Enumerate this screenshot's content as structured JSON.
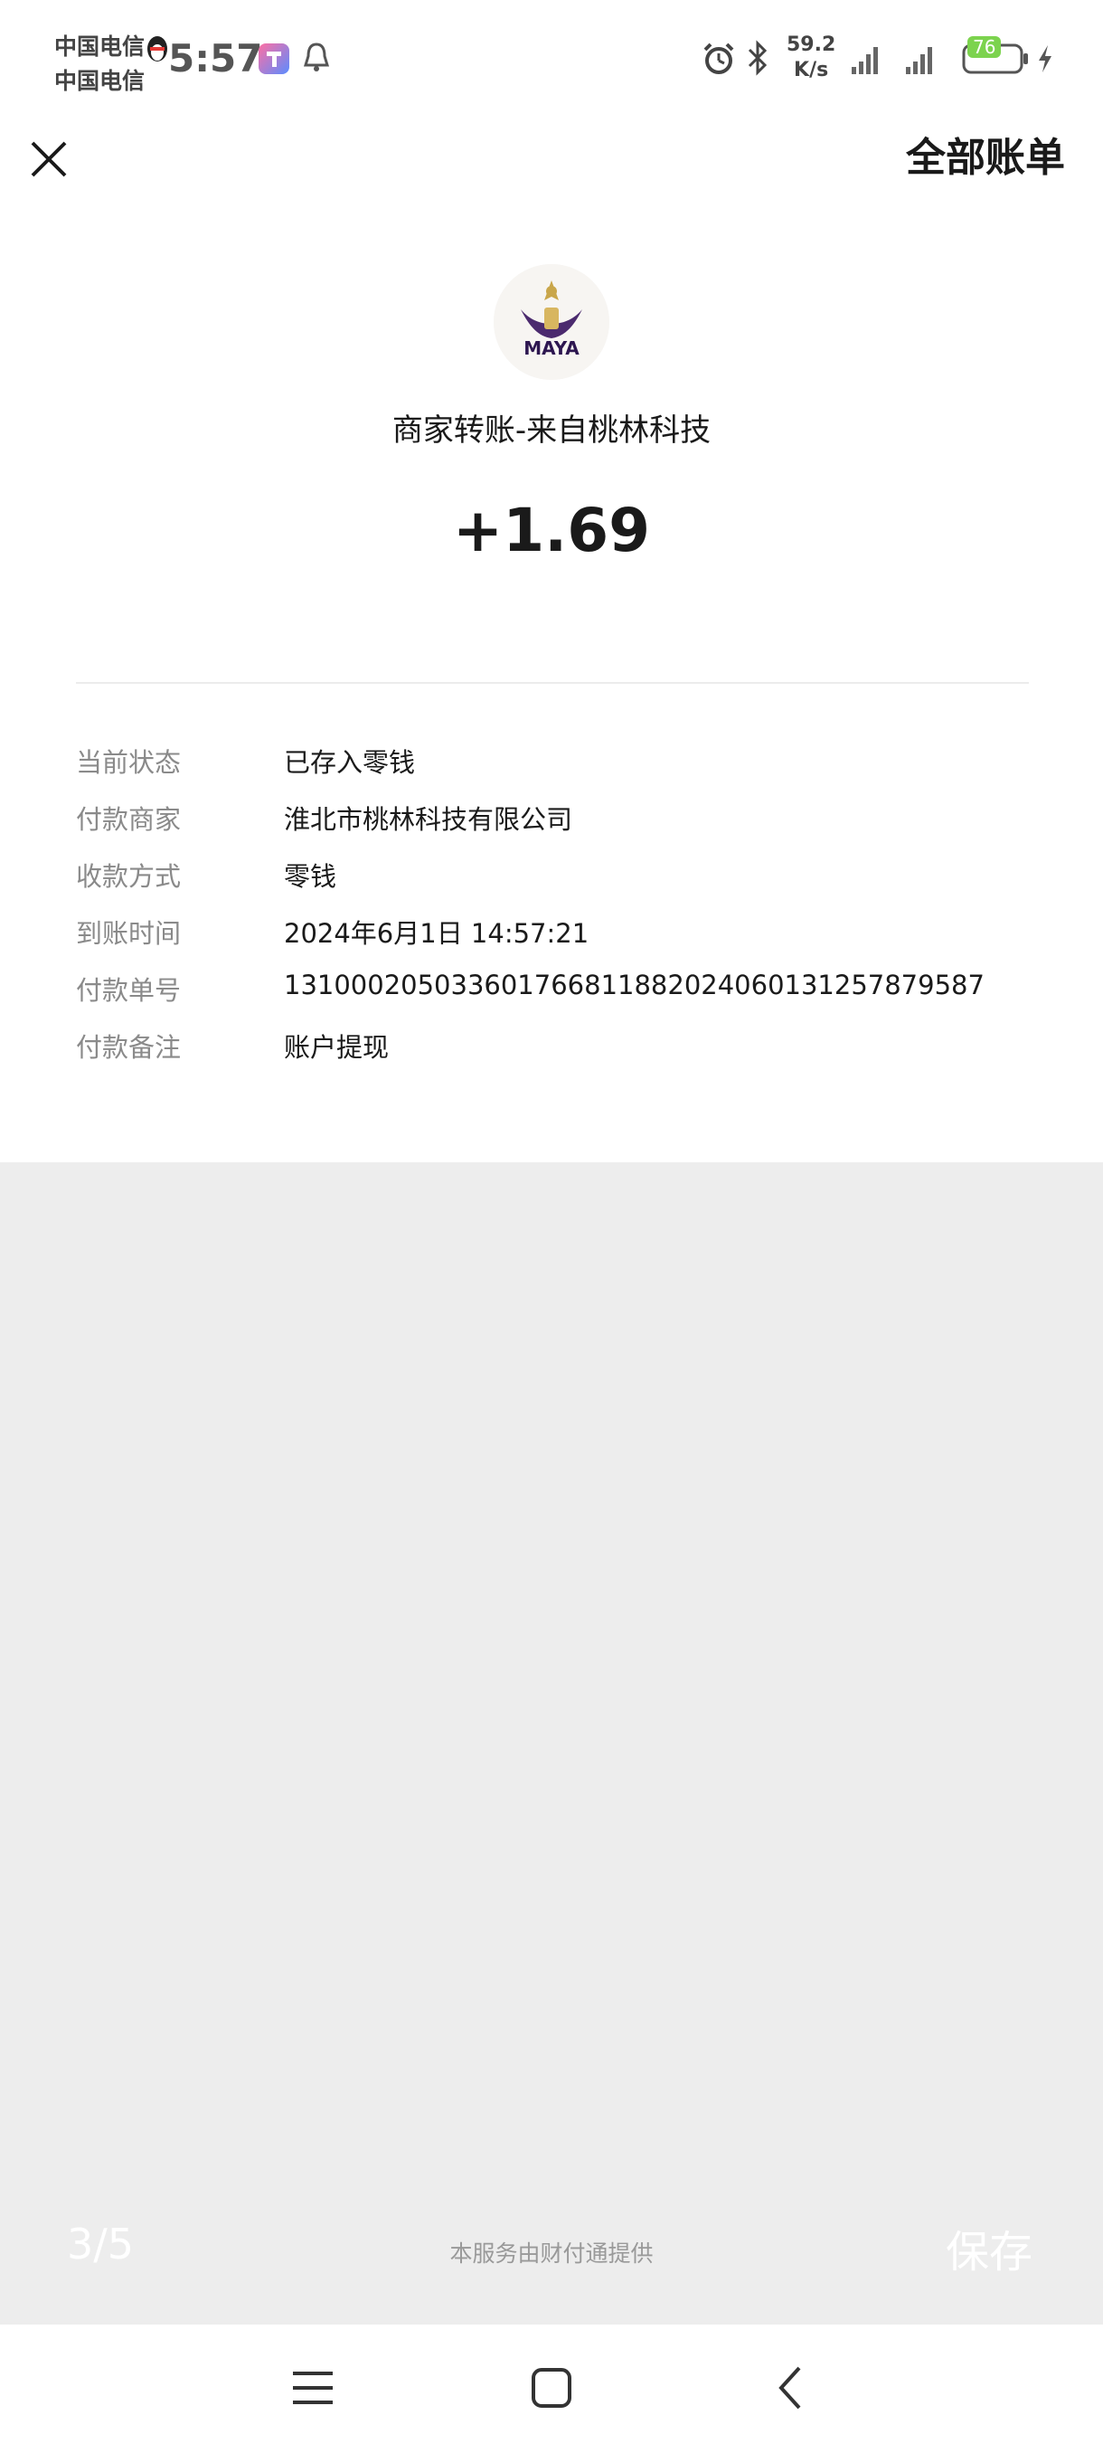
{
  "status_bar": {
    "carrier_1": "中国电信",
    "carrier_2": "中国电信",
    "time": "5:57",
    "net_speed_value": "59.2",
    "net_speed_unit": "K/s",
    "battery": "76",
    "icons": [
      "qq-penguin-icon",
      "app-icon",
      "notification-bell-icon",
      "alarm-icon",
      "bluetooth-icon",
      "signal-icon",
      "battery-icon",
      "charging-icon"
    ]
  },
  "header": {
    "close_icon": "close-icon",
    "all_bills_label": "全部账单"
  },
  "transaction": {
    "logo_text": "MAYA",
    "title": "商家转账-来自桃林科技",
    "amount": "+1.69"
  },
  "details": [
    {
      "label": "当前状态",
      "value": "已存入零钱"
    },
    {
      "label": "付款商家",
      "value": "淮北市桃林科技有限公司"
    },
    {
      "label": "收款方式",
      "value": "零钱"
    },
    {
      "label": "到账时间",
      "value": "2024年6月1日 14:57:21"
    },
    {
      "label": "付款单号",
      "value": "131000205033601766811882024060131257879587"
    },
    {
      "label": "付款备注",
      "value": "账户提现"
    }
  ],
  "bottom": {
    "page_count": "3/5",
    "service_note": "本服务由财付通提供",
    "save_label": "保存"
  },
  "nav": {
    "menu_icon": "menu-icon",
    "home_icon": "home-icon",
    "back_icon": "back-icon"
  },
  "colors": {
    "background": "#ededed",
    "card": "#ffffff",
    "text_primary": "#1a1a1a",
    "text_secondary": "#8a8a8a",
    "battery_green": "#7cd34e"
  }
}
